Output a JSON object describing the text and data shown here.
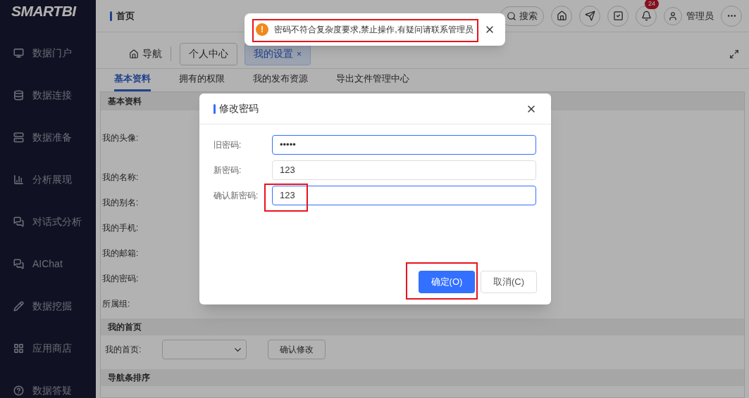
{
  "sidebar": {
    "logo": "SMARTBI",
    "items": [
      {
        "label": "数据门户"
      },
      {
        "label": "数据连接"
      },
      {
        "label": "数据准备"
      },
      {
        "label": "分析展现"
      },
      {
        "label": "对话式分析"
      },
      {
        "label": "AIChat"
      },
      {
        "label": "数据挖掘"
      },
      {
        "label": "应用商店"
      },
      {
        "label": "数据答疑"
      }
    ]
  },
  "header": {
    "breadcrumb": "首页",
    "search": "搜索",
    "notification_count": "24",
    "user": "管理员"
  },
  "tab_bar": {
    "nav": "导航",
    "tabs": [
      {
        "label": "个人中心",
        "selected": false,
        "closable": false
      },
      {
        "label": "我的设置",
        "selected": true,
        "closable": true
      }
    ],
    "close_mark": "×"
  },
  "sub_tabs": [
    {
      "label": "基本资料",
      "selected": true
    },
    {
      "label": "拥有的权限",
      "selected": false
    },
    {
      "label": "我的发布资源",
      "selected": false
    },
    {
      "label": "导出文件管理中心",
      "selected": false
    }
  ],
  "profile": {
    "section": "基本资料",
    "labels": [
      "我的头像:",
      "我的名称:",
      "我的别名:",
      "我的手机:",
      "我的邮箱:",
      "我的密码:",
      "所属组:"
    ]
  },
  "homepage": {
    "section": "我的首页",
    "label": "我的首页:",
    "confirm": "确认修改"
  },
  "nav_order": {
    "section": "导航条排序"
  },
  "dialog": {
    "title": "修改密码",
    "fields": [
      {
        "label": "旧密码:",
        "value": "•••••",
        "focused": true
      },
      {
        "label": "新密码:",
        "value": "123",
        "focused": false
      },
      {
        "label": "确认新密码:",
        "value": "123",
        "focused": true
      }
    ],
    "ok": "确定(O)",
    "cancel": "取消(C)"
  },
  "toast": {
    "message": "密码不符合复杂度要求,禁止操作,有疑问请联系管理员",
    "icon": "!"
  }
}
